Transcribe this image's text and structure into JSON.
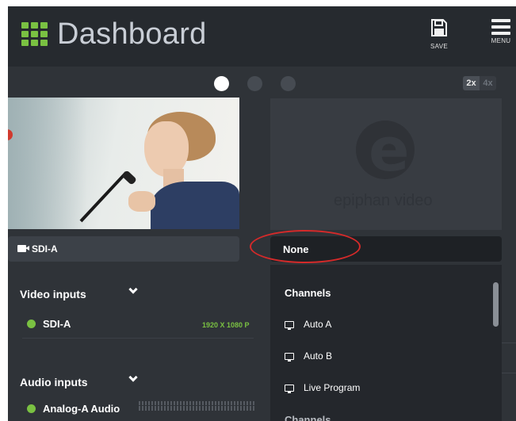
{
  "header": {
    "title": "Dashboard",
    "save_label": "SAVE",
    "menu_label": "MENU"
  },
  "pager": {
    "pages": 3,
    "active_page": 1
  },
  "zoom": {
    "options": [
      "2x",
      "4x"
    ],
    "selected": "2x"
  },
  "left_source": {
    "label": "SDI-A"
  },
  "right_source": {
    "selected": "None",
    "watermark": "epiphan video"
  },
  "video_inputs": {
    "heading": "Video inputs",
    "items": [
      {
        "label": "SDI-A",
        "resolution": "1920 X 1080 P"
      }
    ]
  },
  "audio_inputs": {
    "heading": "Audio inputs",
    "items": [
      {
        "label": "Analog-A Audio"
      }
    ]
  },
  "dropdown": {
    "heading": "Channels",
    "items": [
      {
        "label": "Auto A"
      },
      {
        "label": "Auto B"
      },
      {
        "label": "Live Program"
      }
    ],
    "next_heading": "Channels"
  },
  "colors": {
    "accent_green": "#7ac142",
    "highlight_red": "#d42a2a",
    "background": "#2f3338"
  },
  "icons": {
    "logo": "grid-logo-icon",
    "save": "floppy-disk-icon",
    "menu": "hamburger-icon",
    "camera": "camera-icon",
    "monitor": "monitor-icon",
    "chevron": "chevron-down-icon"
  }
}
